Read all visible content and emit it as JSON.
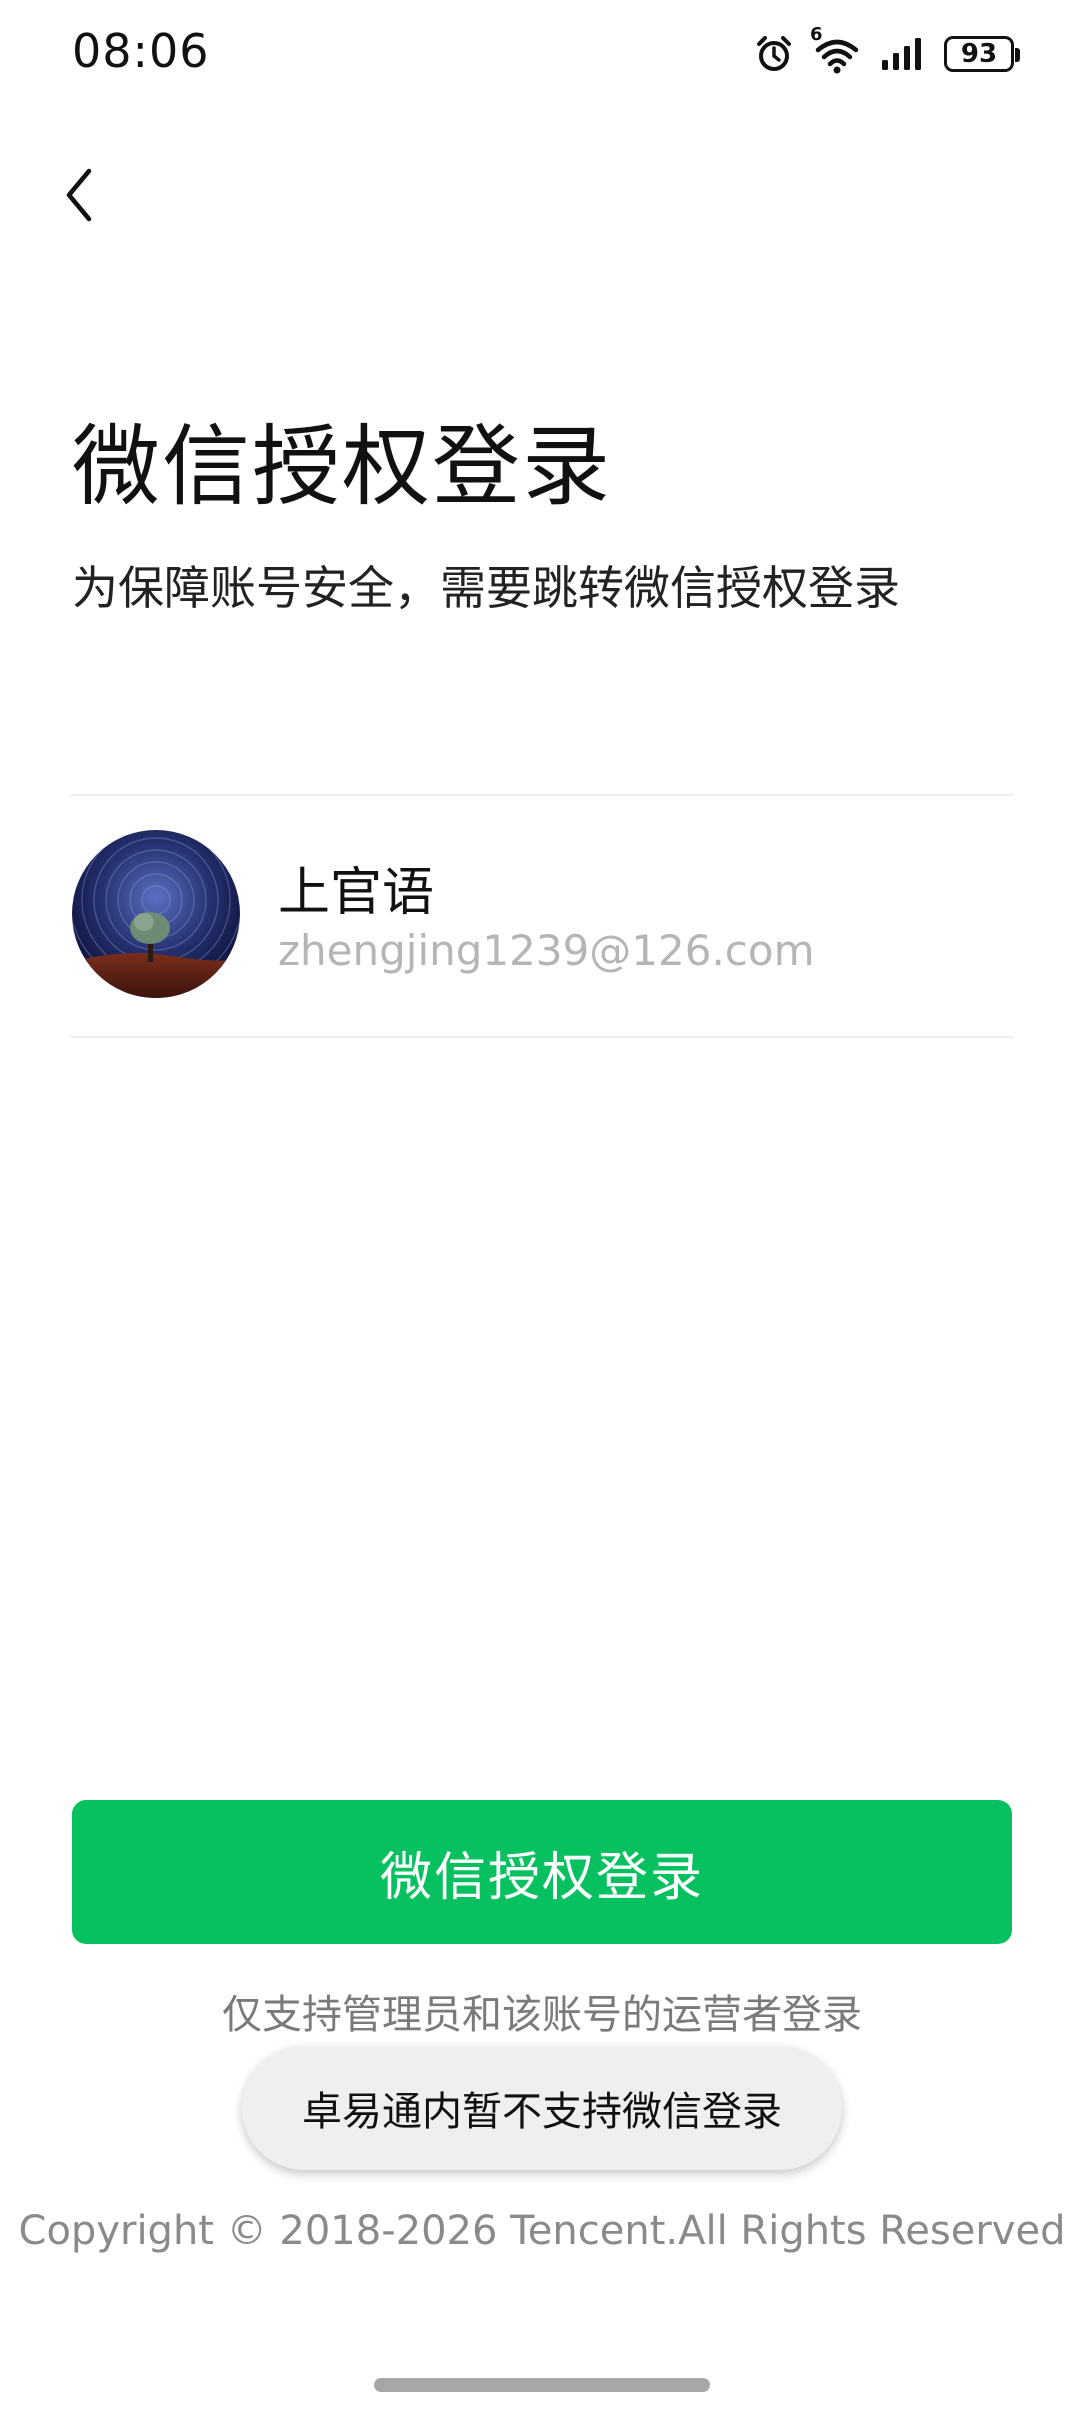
{
  "status_bar": {
    "time": "08:06",
    "icons": [
      "alarm-icon",
      "wifi-icon",
      "signal-icon",
      "battery-icon"
    ],
    "wifi_badge": "6",
    "battery_level": "93"
  },
  "nav": {
    "back_icon": "chevron-left-icon"
  },
  "header": {
    "title": "微信授权登录",
    "subtitle": "为保障账号安全，需要跳转微信授权登录"
  },
  "account": {
    "name": "上官语",
    "email": "zhengjing1239@126.com",
    "avatar": "starry-night-tree-avatar"
  },
  "actions": {
    "primary_label": "微信授权登录",
    "primary_color": "#07c160",
    "support_note": "仅支持管理员和该账号的运营者登录"
  },
  "toast": {
    "message": "卓易通内暂不支持微信登录"
  },
  "footer": {
    "copyright": "Copyright © 2018-2026 Tencent.All Rights Reserved"
  }
}
